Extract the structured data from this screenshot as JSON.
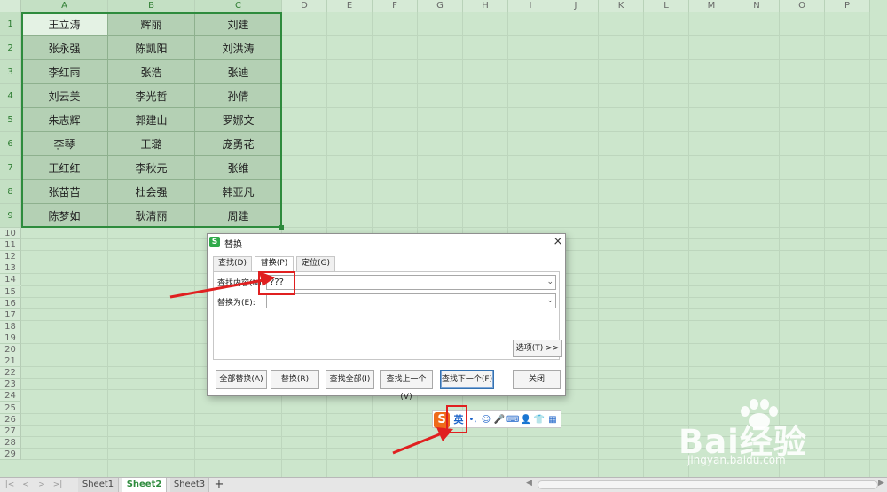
{
  "columns": [
    "A",
    "B",
    "C",
    "D",
    "E",
    "F",
    "G",
    "H",
    "I",
    "J",
    "K",
    "L",
    "M",
    "N",
    "O",
    "P"
  ],
  "rows": [
    "1",
    "2",
    "3",
    "4",
    "5",
    "6",
    "7",
    "8",
    "9",
    "10",
    "11",
    "12",
    "13",
    "14",
    "15",
    "16",
    "17",
    "18",
    "19",
    "20",
    "21",
    "22",
    "23",
    "24",
    "25",
    "26",
    "27",
    "28",
    "29"
  ],
  "cells": [
    [
      "王立涛",
      "辉丽",
      "刘建"
    ],
    [
      "张永强",
      "陈凯阳",
      "刘洪涛"
    ],
    [
      "李红雨",
      "张浩",
      "张迪"
    ],
    [
      "刘云美",
      "李光哲",
      "孙倩"
    ],
    [
      "朱志辉",
      "郭建山",
      "罗娜文"
    ],
    [
      "李琴",
      "王璐",
      "庞勇花"
    ],
    [
      "王红红",
      "李秋元",
      "张维"
    ],
    [
      "张苗苗",
      "杜会强",
      "韩亚凡"
    ],
    [
      "陈梦如",
      "耿清丽",
      "周建"
    ]
  ],
  "sheet_tabs": [
    "Sheet1",
    "Sheet2",
    "Sheet3"
  ],
  "active_sheet": "Sheet2",
  "add_sheet_label": "+",
  "nav_buttons": [
    "|<",
    "<",
    ">",
    ">|"
  ],
  "dialog": {
    "logo": "S",
    "title": "替换",
    "close": "×",
    "tabs": [
      "查找(D)",
      "替换(P)",
      "定位(G)"
    ],
    "active_tab": "替换(P)",
    "find_label": "查找内容(N):",
    "find_value": "???",
    "replace_label": "替换为(E):",
    "replace_value": "",
    "options_label": "选项(T) >>",
    "buttons": [
      "全部替换(A)",
      "替换(R)",
      "查找全部(I)",
      "查找上一个(V)",
      "查找下一个(F)",
      "关闭"
    ]
  },
  "ime": {
    "logo": "S",
    "lang": "英",
    "icons": [
      "punct-icon",
      "emoji-icon",
      "mic-icon",
      "keyboard-icon",
      "user-icon",
      "shirt-icon",
      "grid-icon"
    ],
    "glyphs": [
      "•,",
      "☺",
      "🎤",
      "⌨",
      "👤",
      "👕",
      "▦"
    ]
  },
  "watermark": {
    "brand": "Bai经验",
    "url": "jingyan.baidu.com"
  },
  "colors": {
    "sheet_bg": "#cce6cc",
    "cell_fill": "#b4d0b4",
    "selection_border": "#2e8b3d",
    "annotation_red": "#e02020",
    "ime_orange": "#ef6a1a",
    "ime_blue": "#1b62c8"
  }
}
